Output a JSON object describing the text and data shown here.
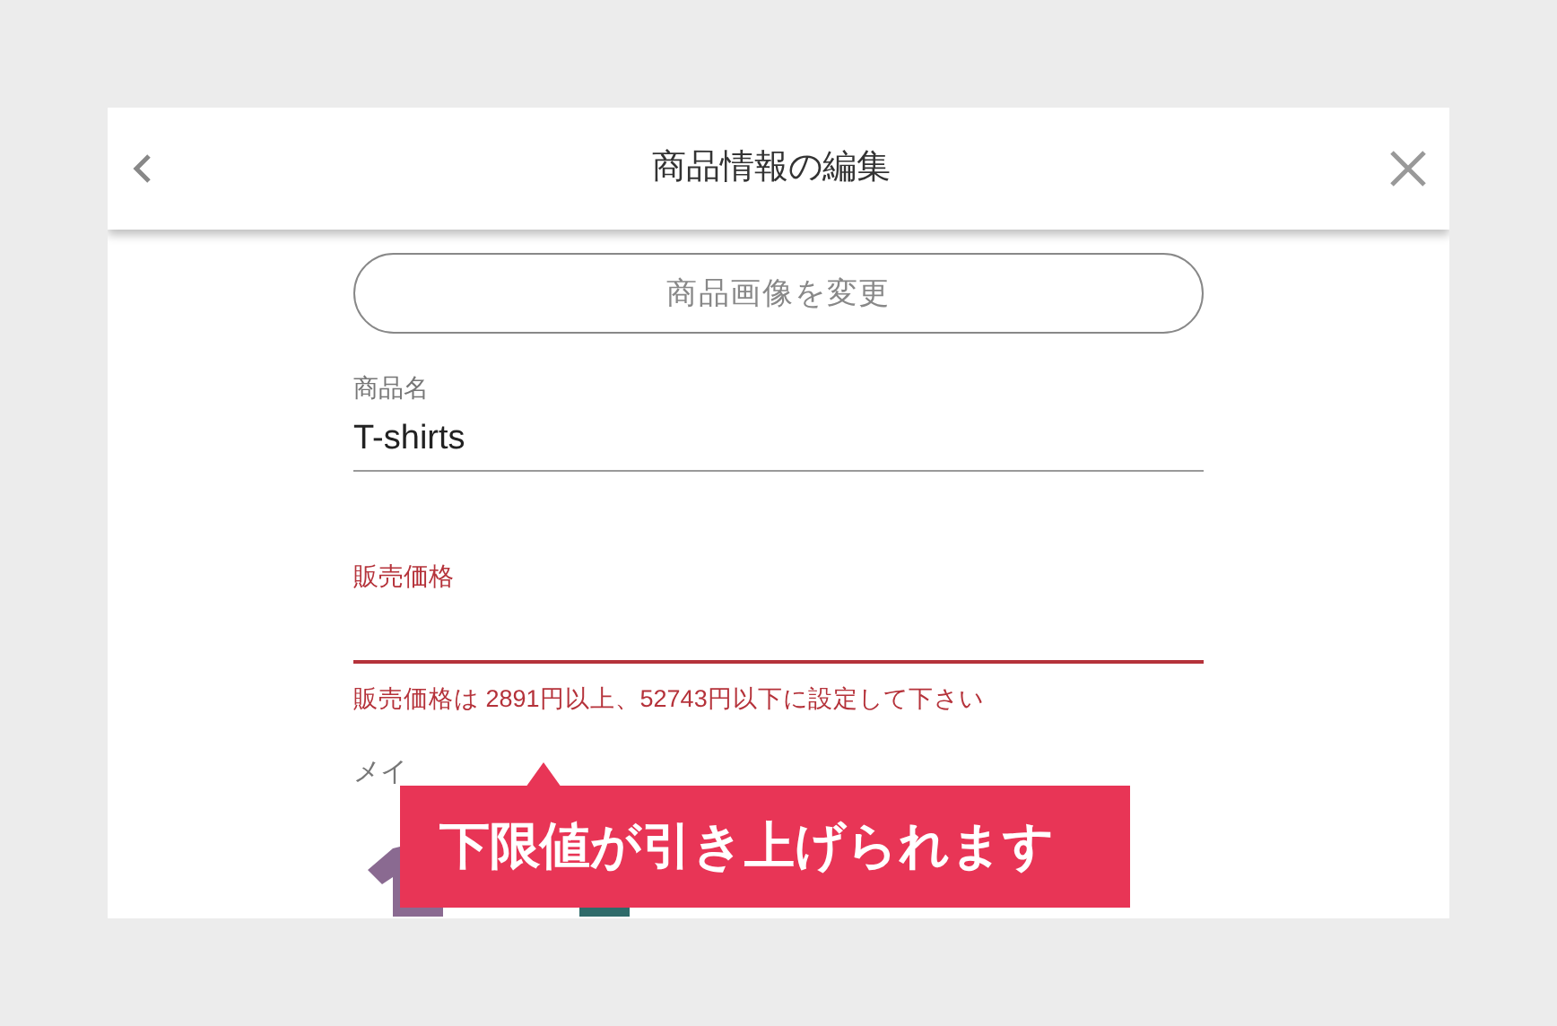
{
  "header": {
    "title": "商品情報の編集"
  },
  "change_image_button": "商品画像を変更",
  "fields": [
    {
      "label": "商品名",
      "value": "T-shirts",
      "error": false
    },
    {
      "label": "販売価格",
      "error": true,
      "error_message": "販売価格は 2891円以上、52743円以下に設定して下さい"
    }
  ],
  "color_section": {
    "label": "メイ",
    "swatches": [
      {
        "color": "#8a6a91"
      },
      {
        "color": "#2f6b6a"
      }
    ]
  },
  "tooltip": "下限値が引き上げられます"
}
